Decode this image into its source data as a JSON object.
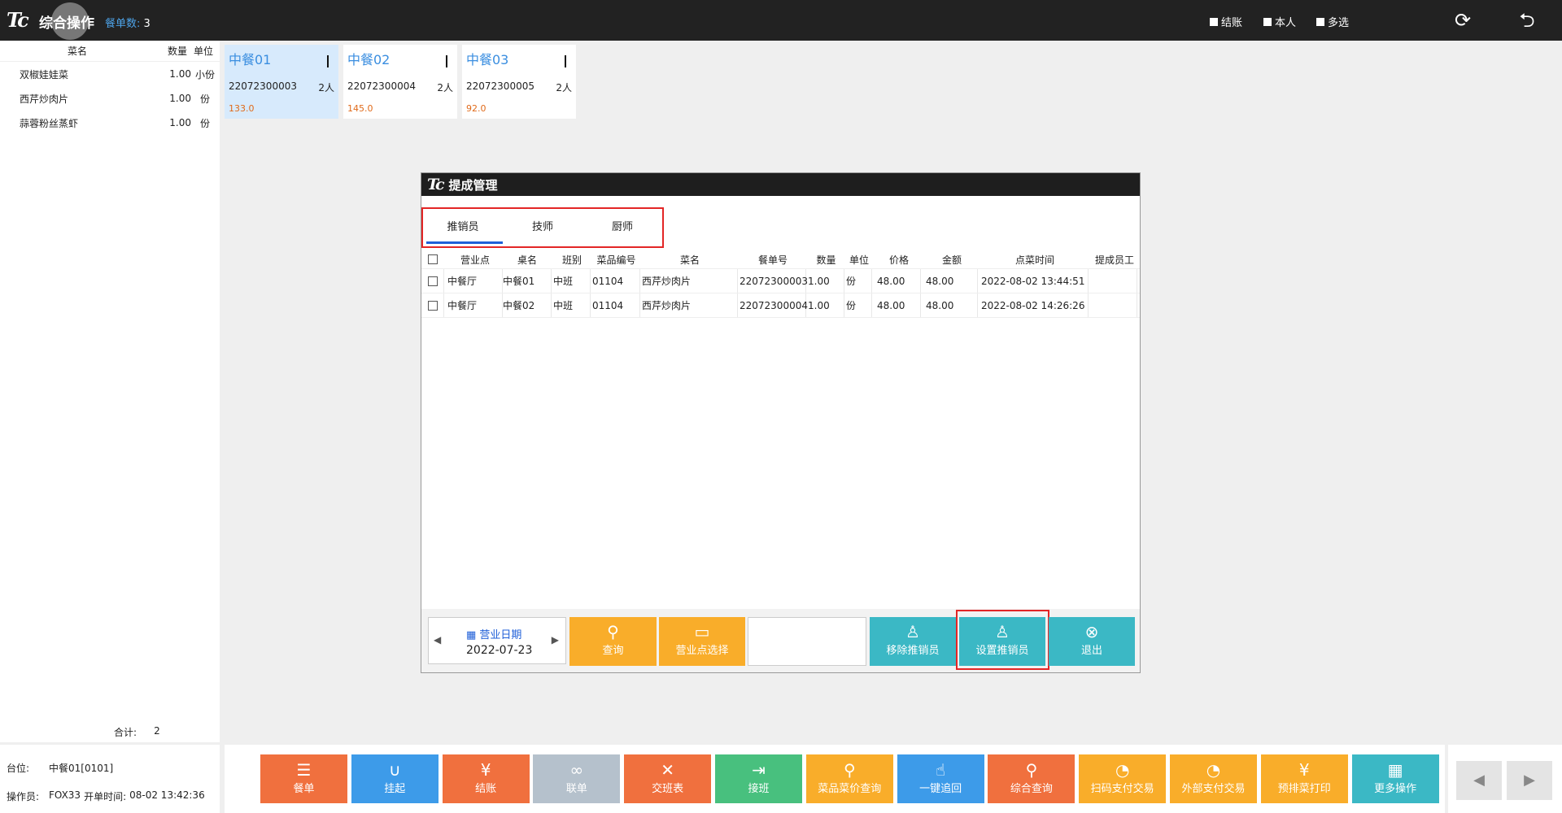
{
  "topbar": {
    "logo": "Tc",
    "title": "综合操作",
    "order_count_label": "餐单数:",
    "order_count_value": "3",
    "options": [
      "结账",
      "本人",
      "多选"
    ]
  },
  "left_panel": {
    "headers": [
      "菜名",
      "数量",
      "单位"
    ],
    "items": [
      {
        "name": "双椒娃娃菜",
        "qty": "1.00",
        "unit": "小份"
      },
      {
        "name": "西芹炒肉片",
        "qty": "1.00",
        "unit": "份"
      },
      {
        "name": "蒜蓉粉丝蒸虾",
        "qty": "1.00",
        "unit": "份"
      }
    ],
    "total_label": "合计:",
    "total_value": "2",
    "table_label": "台位:",
    "table_value": "中餐01[0101]",
    "operator_label": "操作员:",
    "operator_value": "FOX33",
    "open_time_label": "开单时间:",
    "open_time_value": "08-02 13:42:36"
  },
  "table_cards": [
    {
      "name": "中餐01",
      "order_no": "22072300003",
      "people": "2人",
      "amount": "133.0",
      "selected": true
    },
    {
      "name": "中餐02",
      "order_no": "22072300004",
      "people": "2人",
      "amount": "145.0",
      "selected": false
    },
    {
      "name": "中餐03",
      "order_no": "22072300005",
      "people": "2人",
      "amount": "92.0",
      "selected": false
    }
  ],
  "dialog": {
    "logo": "Tc",
    "title": "提成管理",
    "tabs": [
      "推销员",
      "技师",
      "厨师"
    ],
    "active_tab": "推销员",
    "columns": [
      "营业点",
      "桌名",
      "班别",
      "菜品编号",
      "菜名",
      "餐单号",
      "数量",
      "单位",
      "价格",
      "金额",
      "点菜时间",
      "提成员工"
    ],
    "rows": [
      [
        "中餐厅",
        "中餐01",
        "中班",
        "01104",
        "西芹炒肉片",
        "22072300003",
        "1.00",
        "份",
        "48.00",
        "48.00",
        "2022-08-02 13:44:51",
        ""
      ],
      [
        "中餐厅",
        "中餐02",
        "中班",
        "01104",
        "西芹炒肉片",
        "22072300004",
        "1.00",
        "份",
        "48.00",
        "48.00",
        "2022-08-02 14:26:26",
        ""
      ]
    ],
    "date_label": "营业日期",
    "date_value": "2022-07-23",
    "buttons": {
      "query": "查询",
      "outlet_select": "营业点选择",
      "remove_sales": "移除推销员",
      "set_sales": "设置推销员",
      "exit": "退出"
    },
    "colors": {
      "orange": "#f9ad2a",
      "teal": "#3bb8c5"
    }
  },
  "bottom_buttons": [
    {
      "label": "餐单",
      "color": "#f0703e",
      "icon": "list-icon"
    },
    {
      "label": "挂起",
      "color": "#3d9be9",
      "icon": "magnet-icon"
    },
    {
      "label": "结账",
      "color": "#f0703e",
      "icon": "yen-icon"
    },
    {
      "label": "联单",
      "color": "#b5c1cc",
      "icon": "link-icon"
    },
    {
      "label": "交班表",
      "color": "#f0703e",
      "icon": "tools-icon"
    },
    {
      "label": "接班",
      "color": "#48c07e",
      "icon": "user-shift-icon"
    },
    {
      "label": "菜品菜价查询",
      "color": "#f9ad2a",
      "icon": "search-icon"
    },
    {
      "label": "一键追回",
      "color": "#3d9be9",
      "icon": "hand-icon"
    },
    {
      "label": "综合查询",
      "color": "#f0703e",
      "icon": "search-icon"
    },
    {
      "label": "扫码支付交易",
      "color": "#f9ad2a",
      "icon": "pie-icon"
    },
    {
      "label": "外部支付交易",
      "color": "#f9ad2a",
      "icon": "pie-icon"
    },
    {
      "label": "预排菜打印",
      "color": "#f9ad2a",
      "icon": "yen-icon"
    },
    {
      "label": "更多操作",
      "color": "#3bb8c5",
      "icon": "grid-icon"
    }
  ]
}
